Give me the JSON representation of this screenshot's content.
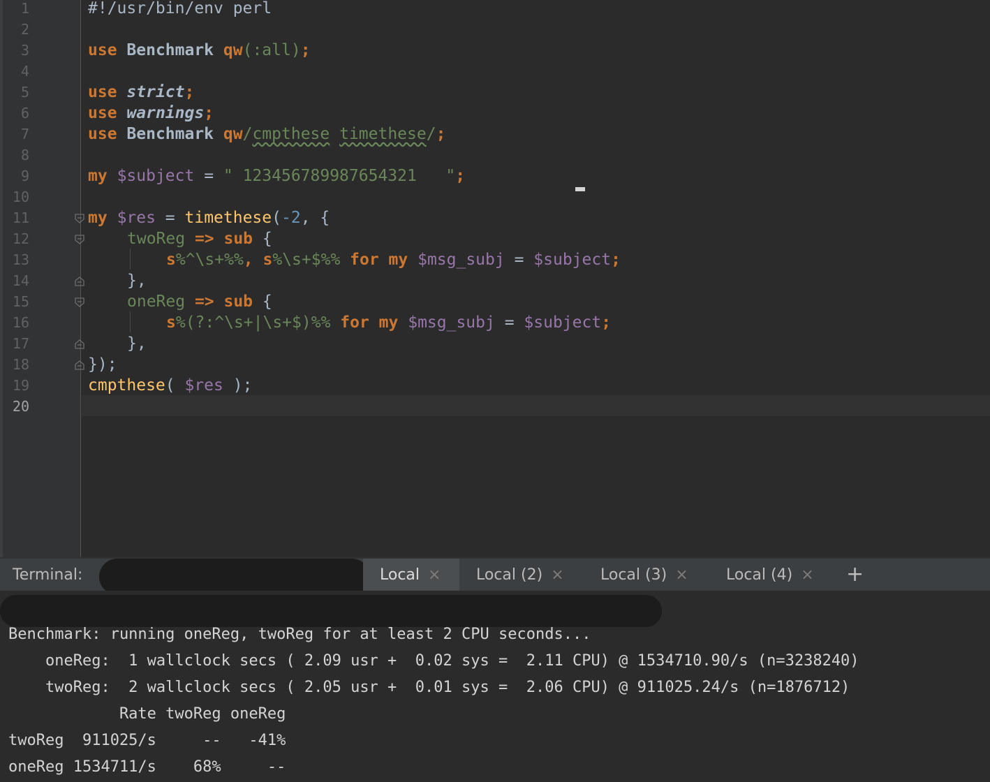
{
  "editor": {
    "line_numbers": [
      "1",
      "2",
      "3",
      "4",
      "5",
      "6",
      "7",
      "8",
      "9",
      "10",
      "11",
      "12",
      "13",
      "14",
      "15",
      "16",
      "17",
      "18",
      "19",
      "20"
    ],
    "current_line": "20",
    "code": {
      "l1": "#!/usr/bin/env perl",
      "l3_use": "use",
      "l3_pkg": "Benchmark",
      "l3_qw": "qw",
      "l3_args": "(:all)",
      "l3_end": ";",
      "l5_use": "use",
      "l5_prg": "strict",
      "l5_end": ";",
      "l6_use": "use",
      "l6_prg": "warnings",
      "l6_end": ";",
      "l7_use": "use",
      "l7_pkg": "Benchmark",
      "l7_qw": "qw",
      "l7_open": "/",
      "l7_w1": "cmpthese",
      "l7_w2": "timethese",
      "l7_close": "/",
      "l7_end": ";",
      "l9_my": "my",
      "l9_var": "$subject",
      "l9_eq": " = ",
      "l9_str": "\" 123456789987654321   \"",
      "l9_end": ";",
      "l11_my": "my",
      "l11_var": "$res",
      "l11_eq": " = ",
      "l11_fn": "timethese",
      "l11_open": "(",
      "l11_num": "-2",
      "l11_rest": ", {",
      "l12_key": "twoReg",
      "l12_arrow": " => ",
      "l12_sub": "sub",
      "l12_brace": " {",
      "l13_s1": "s",
      "l13_re1": "%^\\s+%%",
      "l13_sep": ", ",
      "l13_s2": "s",
      "l13_re2": "%\\s+$%%",
      "l13_for": " for ",
      "l13_my": "my",
      "l13_var": " $msg_subj",
      "l13_eq": " = ",
      "l13_var2": "$subject",
      "l13_end": ";",
      "l14": "},",
      "l15_key": "oneReg",
      "l15_arrow": " => ",
      "l15_sub": "sub",
      "l15_brace": " {",
      "l16_s": "s",
      "l16_re": "%(?:^\\s+|\\s+$)%%",
      "l16_for": " for ",
      "l16_my": "my",
      "l16_var": " $msg_subj",
      "l16_eq": " = ",
      "l16_var2": "$subject",
      "l16_end": ";",
      "l17": "},",
      "l18": "});",
      "l19_fn": "cmpthese",
      "l19_open": "( ",
      "l19_var": "$res",
      "l19_close": " );"
    }
  },
  "terminal": {
    "label": "Terminal:",
    "tabs": [
      {
        "label": "Local",
        "close": "×"
      },
      {
        "label": "Local (2)",
        "close": "×"
      },
      {
        "label": "Local (3)",
        "close": "×"
      },
      {
        "label": "Local (4)",
        "close": "×"
      }
    ],
    "add_tab": "+",
    "output": [
      "Benchmark: running oneReg, twoReg for at least 2 CPU seconds...",
      "    oneReg:  1 wallclock secs ( 2.09 usr +  0.02 sys =  2.11 CPU) @ 1534710.90/s (n=3238240)",
      "    twoReg:  2 wallclock secs ( 2.05 usr +  0.01 sys =  2.06 CPU) @ 911025.24/s (n=1876712)",
      "            Rate twoReg oneReg",
      "twoReg  911025/s     --   -41%",
      "oneReg 1534711/s    68%     --"
    ]
  }
}
